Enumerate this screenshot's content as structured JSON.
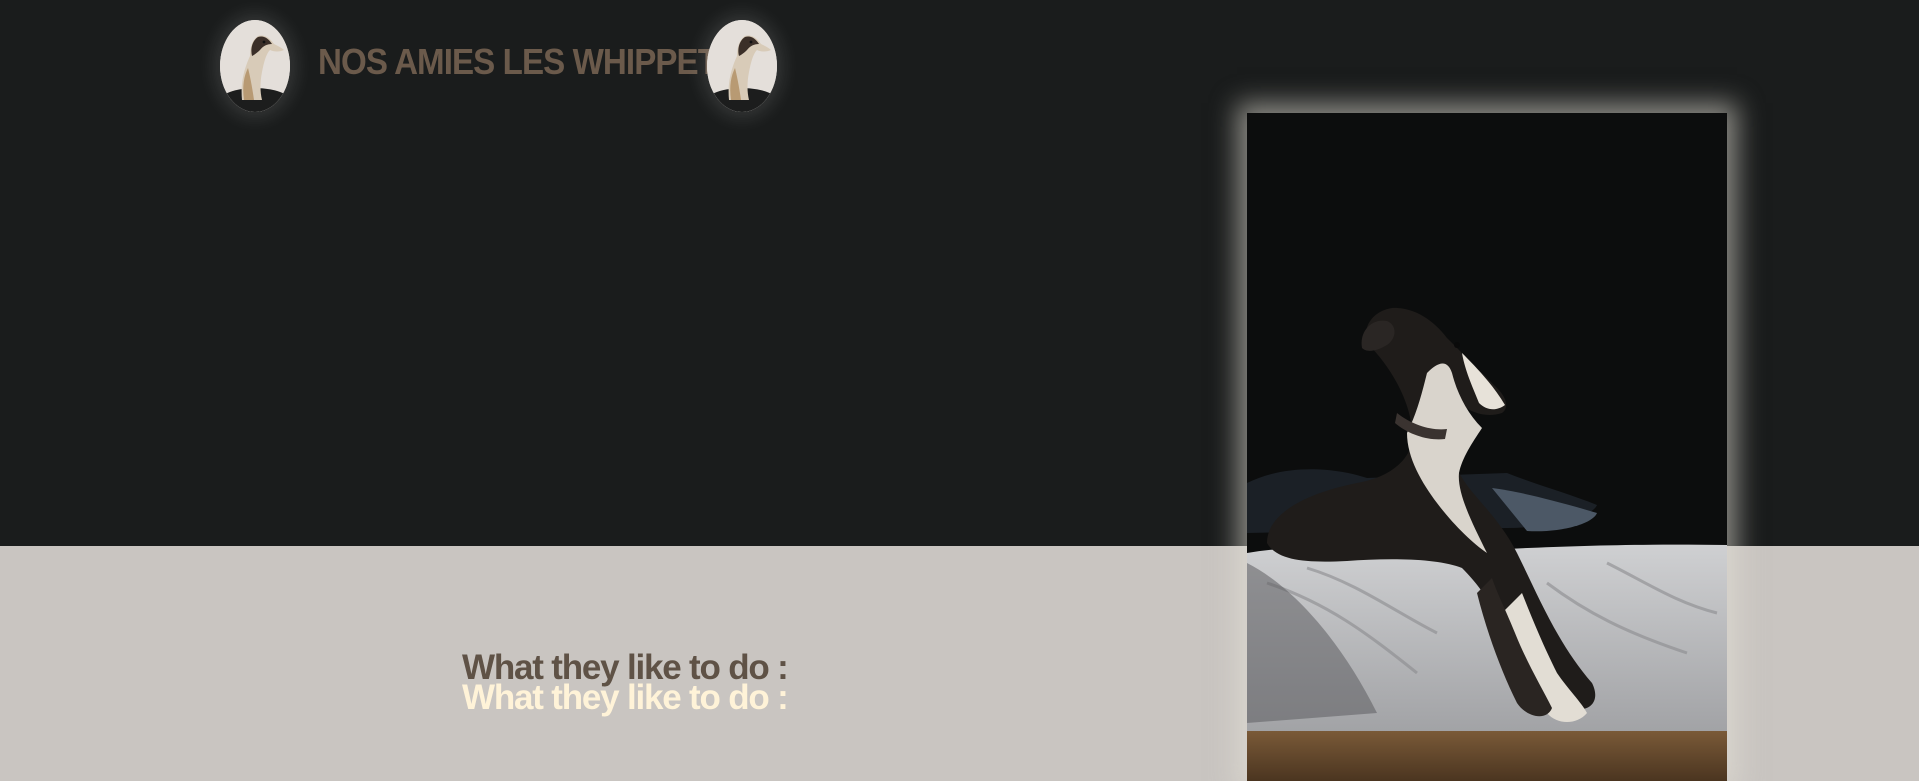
{
  "header": {
    "title": "NOS AMIES LES WHIPPET",
    "left_avatar_icon": "whippet-portrait-icon",
    "right_avatar_icon": "whippet-portrait-icon"
  },
  "hero": {
    "image": "whippet-on-bed-photo"
  },
  "section": {
    "heading": "What they like to do :",
    "heading_shadow": "What they like to do :"
  },
  "colors": {
    "top_background": "#1a1c1c",
    "bottom_background": "#c9c5c1",
    "title_color": "#6b5a4b",
    "heading_dark": "#5f5246",
    "heading_light": "#fff3d8"
  }
}
